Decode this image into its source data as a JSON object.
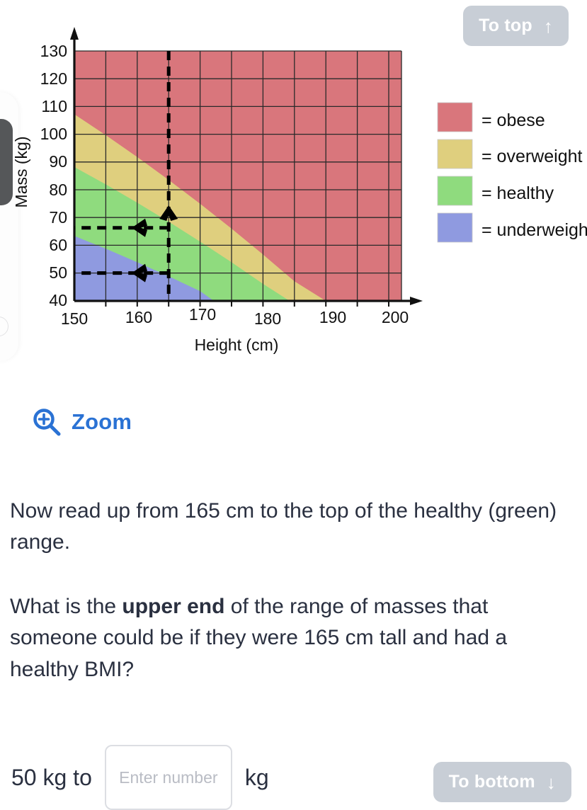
{
  "nav": {
    "to_top_label": "To top",
    "to_top_icon": "arrow-up-icon",
    "to_top_glyph": "↑",
    "to_bottom_label": "To bottom",
    "to_bottom_icon": "arrow-down-icon",
    "to_bottom_glyph": "↓"
  },
  "zoom": {
    "label": "Zoom",
    "icon": "zoom-in-magnifier-icon",
    "color": "#2a72d4"
  },
  "prose": {
    "paragraph_1": "Now read up from 165 cm to the top of the healthy (green) range.",
    "question_prefix": "What is the ",
    "question_bold": "upper end",
    "question_suffix": " of the range of masses that someone could be if they were 165 cm tall and had a healthy BMI?"
  },
  "answer": {
    "prefix_label": "50 kg to",
    "input_value": "",
    "input_placeholder": "Enter number",
    "suffix_label": "kg"
  },
  "chart_data": {
    "type": "area",
    "title": "",
    "xlabel": "Height (cm)",
    "ylabel": "Mass (kg)",
    "xlim": [
      150,
      202
    ],
    "ylim": [
      40,
      130
    ],
    "xticks": [
      150,
      160,
      170,
      180,
      190,
      200
    ],
    "xtick_labels": [
      "150",
      "160",
      "170",
      "180",
      "190",
      "200"
    ],
    "yticks": [
      40,
      50,
      60,
      70,
      80,
      90,
      100,
      110,
      120,
      130
    ],
    "ytick_labels": [
      "40",
      "50",
      "60",
      "70",
      "80",
      "90",
      "100",
      "110",
      "120",
      "130"
    ],
    "grid": true,
    "grid_x_step": 5,
    "grid_y_step": 10,
    "legend_position": "right",
    "legend": [
      {
        "label": "= obese",
        "color": "#d9767c",
        "name": "obese"
      },
      {
        "label": "= overweight",
        "color": "#dfcf7e",
        "name": "overweight"
      },
      {
        "label": "= healthy",
        "color": "#8fdb7e",
        "name": "healthy"
      },
      {
        "label": "= underweight",
        "color": "#8f9ae0",
        "name": "underweight"
      }
    ],
    "bands": [
      {
        "name": "underweight",
        "bmi_upper": 18.5,
        "color": "#8f9ae0"
      },
      {
        "name": "healthy",
        "bmi_lower": 18.5,
        "bmi_upper": 25,
        "color": "#8fdb7e"
      },
      {
        "name": "overweight",
        "bmi_lower": 25,
        "bmi_upper": 30,
        "color": "#dfcf7e"
      },
      {
        "name": "obese",
        "bmi_lower": 30,
        "color": "#d9767c"
      }
    ],
    "annotations": [
      {
        "type": "vline",
        "x": 165,
        "style": "dashed",
        "label": "165 cm read-up line"
      },
      {
        "type": "hline",
        "y": 64,
        "x_from": 165,
        "x_to": 150,
        "style": "dashed",
        "arrow": "left",
        "label": "upper healthy mass at 165 cm"
      },
      {
        "type": "hline",
        "y": 50,
        "x_from": 165,
        "x_to": 150,
        "style": "dashed",
        "arrow": "left",
        "label": "lower healthy mass at 165 cm"
      },
      {
        "type": "arrow-up",
        "x": 165,
        "y": 72,
        "label": "read upward arrow"
      }
    ]
  }
}
